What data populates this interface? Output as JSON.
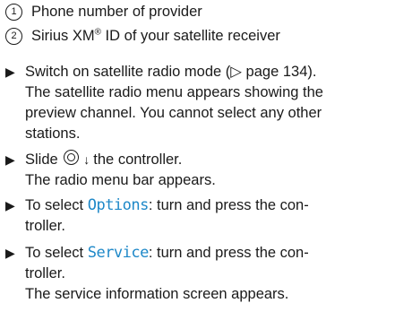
{
  "legend": [
    {
      "marker": "1",
      "text": "Phone number of provider"
    },
    {
      "marker": "2",
      "text_before": "Sirius XM",
      "sup": "®",
      "text_after": " ID of your satellite receiver"
    }
  ],
  "bullet": "▶",
  "steps": [
    {
      "lines": [
        "Switch on satellite radio mode (▷ page 134).",
        "The satellite radio menu appears showing the",
        "preview channel. You cannot select any other",
        "stations."
      ]
    },
    {
      "prefix": "Slide",
      "ctrl_arrow": "↓",
      "suffix": "the controller.",
      "result": "The radio menu bar appears."
    },
    {
      "prefix": "To select",
      "menu": "Options",
      "suffix": ": turn and press the con-",
      "cont": "troller."
    },
    {
      "prefix": "To select",
      "menu": "Service",
      "suffix": ": turn and press the con-",
      "cont": "troller.",
      "result": "The service information screen appears."
    }
  ],
  "colors": {
    "menu_text": "#1e88c8",
    "text": "#1a1a1a"
  },
  "icons": [
    "circled-digit-icon",
    "bullet-triangle-icon",
    "controller-icon"
  ]
}
